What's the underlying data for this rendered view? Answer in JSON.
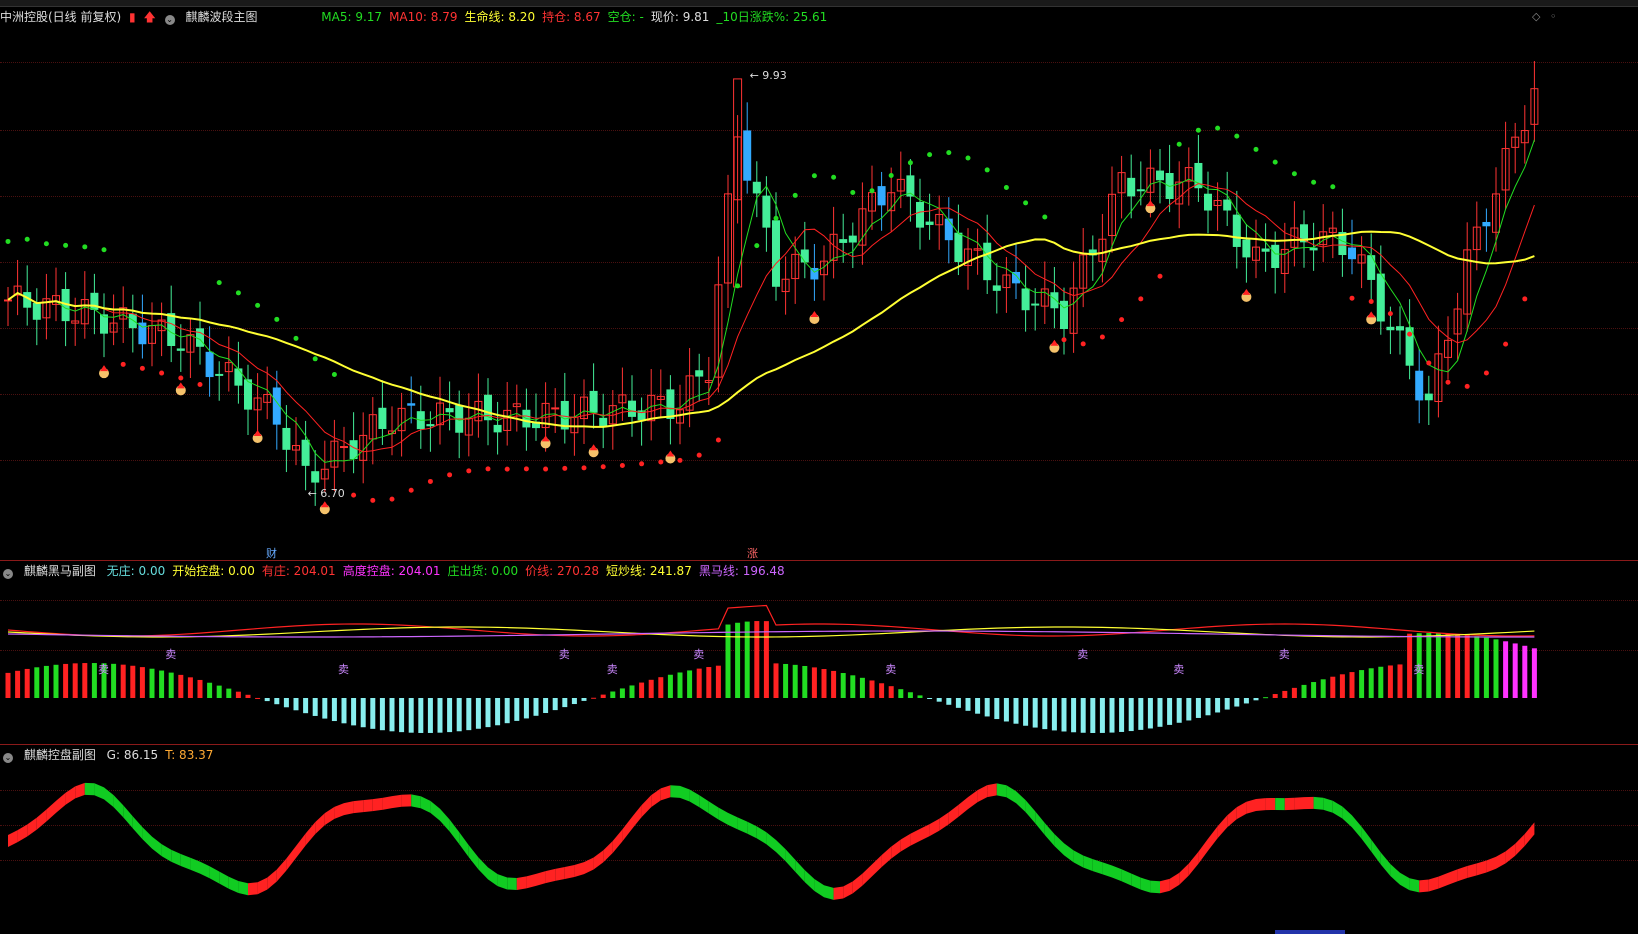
{
  "main": {
    "symbol": "中洲控股(日线 前复权)",
    "indicator_name": "麒麟波段主图",
    "params": [
      {
        "label": "MA5: 9.17",
        "color": "#22dd22"
      },
      {
        "label": "MA10: 8.79",
        "color": "#ff3333"
      },
      {
        "label": "生命线: 8.20",
        "color": "#ffff33"
      },
      {
        "label": "持仓: 8.67",
        "color": "#ff3333"
      },
      {
        "label": "空仓: -",
        "color": "#22dd22"
      },
      {
        "label": "现价: 9.81",
        "color": "#dddddd"
      },
      {
        "label": "_10日涨跌%: 25.61",
        "color": "#22dd22"
      }
    ],
    "high_label": "9.93",
    "low_label": "6.70",
    "badge_cai": "财",
    "badge_zhang": "涨"
  },
  "sub1": {
    "name": "麒麟黑马副图",
    "params": [
      {
        "label": "无庄: 0.00",
        "color": "#66dddd"
      },
      {
        "label": "开始控盘: 0.00",
        "color": "#ffff33"
      },
      {
        "label": "有庄: 204.01",
        "color": "#ff3333"
      },
      {
        "label": "高度控盘: 204.01",
        "color": "#ff33ff"
      },
      {
        "label": "庄出货: 0.00",
        "color": "#22dd22"
      },
      {
        "label": "价线: 270.28",
        "color": "#ff3333"
      },
      {
        "label": "短炒线: 241.87",
        "color": "#ffff33"
      },
      {
        "label": "黑马线: 196.48",
        "color": "#cc66ff"
      }
    ],
    "sell_label": "卖"
  },
  "sub2": {
    "name": "麒麟控盘副图",
    "params": [
      {
        "label": "G: 86.15",
        "color": "#dddddd"
      },
      {
        "label": "T: 83.37",
        "color": "#ffaa33"
      }
    ]
  },
  "colors": {
    "up": "#ff3333",
    "down": "#44ee99",
    "yellow": "#ffff33",
    "green": "#22dd22",
    "red": "#ff2222",
    "cyan": "#88eeee",
    "magenta": "#ff33ff"
  }
}
